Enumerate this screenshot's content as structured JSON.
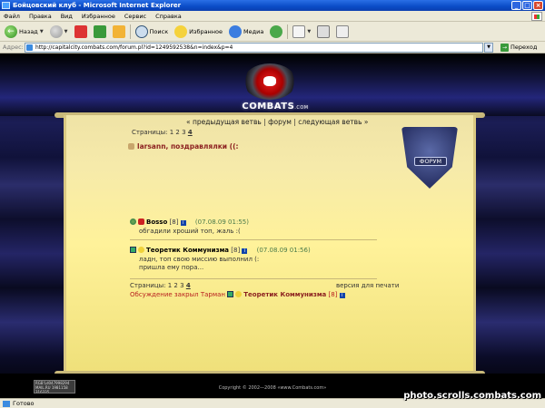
{
  "window": {
    "title": "Бойцовский клуб - Microsoft Internet Explorer",
    "buttons": [
      "_",
      "□",
      "×"
    ]
  },
  "menubar": {
    "items": [
      "Файл",
      "Правка",
      "Вид",
      "Избранное",
      "Сервис",
      "Справка"
    ]
  },
  "toolbar": {
    "back_label": "Назад",
    "search_label": "Поиск",
    "favorites_label": "Избранное",
    "media_label": "Медиа"
  },
  "addressbar": {
    "label": "Адрес:",
    "url": "http://capitalcity.combats.com/forum.pl?id=1249592538&n=index&p=4",
    "go_label": "Переход"
  },
  "site": {
    "logo_text": "COMBATS",
    "logo_domain": ".COM",
    "badge_label": "ФОРУМ"
  },
  "forum": {
    "nav": {
      "prev": "« предыдущая ветвь",
      "sep1": " | ",
      "forum": "форум",
      "sep2": " | ",
      "next": "следующая ветвь »"
    },
    "pages_label": "Страницы:",
    "pages": [
      "1",
      "2",
      "3",
      "4"
    ],
    "current_page": "4",
    "topic_title": "larsann, поздравлялки ((:",
    "posts": [
      {
        "author": "Bosso",
        "level": "[8]",
        "date": "(07.08.09 01:55)",
        "lines": [
          "обгадили хроший топ, жаль :("
        ]
      },
      {
        "author": "Теоретик Коммунизма",
        "level": "[8]",
        "date": "(07.08.09 01:56)",
        "lines": [
          "ладн, топ свою миссию выполнил (:",
          "пришла ему пора..."
        ]
      }
    ],
    "print_label": "версия для печати",
    "closed_text": "Обсуждение закрыл Тарман",
    "closed_by": "Теоретик Коммунизма",
    "closed_by_level": "[8]"
  },
  "footer": {
    "copyright": "Copyright © 2002—2008 «www.Combats.com»",
    "counter_lines": [
      "RGB'Ld047998294",
      "MAIL.RU 1981158",
      "  316335"
    ]
  },
  "statusbar": {
    "text": "Готово"
  },
  "watermark": {
    "text": "photo.scrolls.combats.com"
  }
}
